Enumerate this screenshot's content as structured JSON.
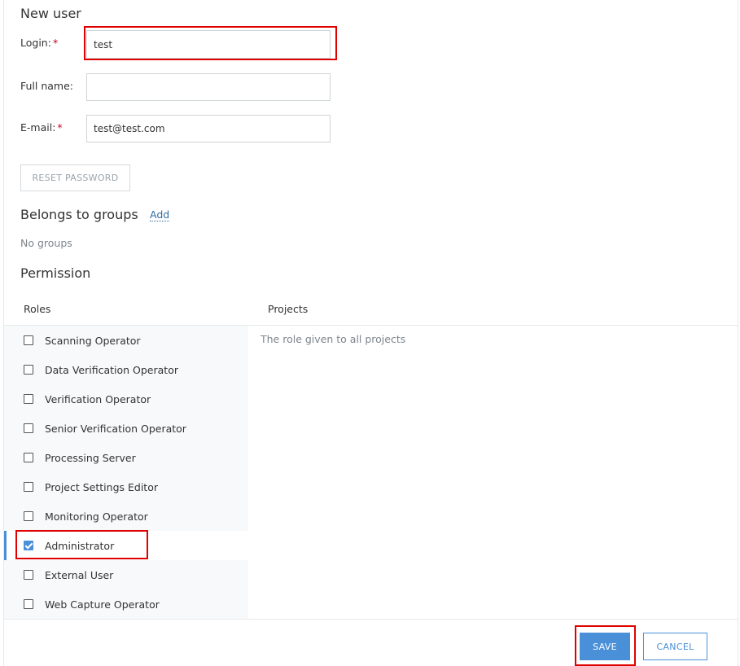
{
  "form": {
    "title": "New user",
    "login": {
      "label": "Login:",
      "required_mark": "*",
      "value": "test"
    },
    "full_name": {
      "label": "Full name:",
      "value": ""
    },
    "email": {
      "label": "E-mail:",
      "required_mark": "*",
      "value": "test@test.com"
    },
    "reset_password_label": "RESET PASSWORD"
  },
  "groups": {
    "title": "Belongs to groups",
    "add_label": "Add",
    "empty_text": "No groups"
  },
  "permission": {
    "title": "Permission",
    "roles_header": "Roles",
    "projects_header": "Projects",
    "projects_note": "The role given to all projects",
    "roles": [
      {
        "label": "Scanning Operator",
        "checked": false
      },
      {
        "label": "Data Verification Operator",
        "checked": false
      },
      {
        "label": "Verification Operator",
        "checked": false
      },
      {
        "label": "Senior Verification Operator",
        "checked": false
      },
      {
        "label": "Processing Server",
        "checked": false
      },
      {
        "label": "Project Settings Editor",
        "checked": false
      },
      {
        "label": "Monitoring Operator",
        "checked": false
      },
      {
        "label": "Administrator",
        "checked": true
      },
      {
        "label": "External User",
        "checked": false
      },
      {
        "label": "Web Capture Operator",
        "checked": false
      }
    ]
  },
  "footer": {
    "save_label": "SAVE",
    "cancel_label": "CANCEL"
  },
  "colors": {
    "accent": "#4a90d9",
    "highlight": "#e00000",
    "required": "#d0021b"
  }
}
